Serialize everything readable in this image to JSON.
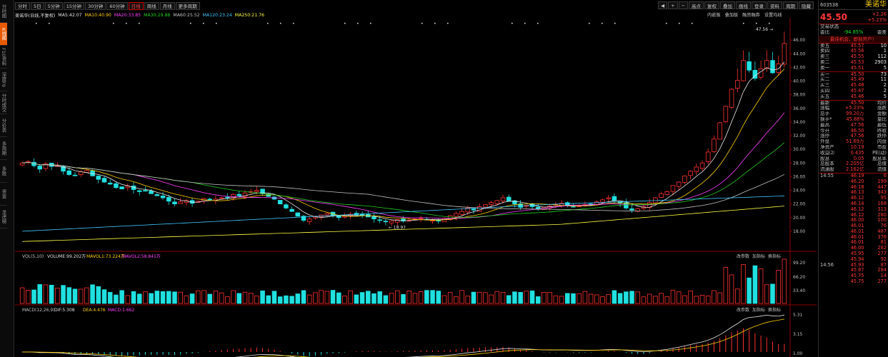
{
  "left_tabs": [
    "分时图",
    "K线图",
    "F10资料",
    "深度F9",
    "分时成交",
    "分价表",
    "多周期",
    "多股",
    "资金",
    "龙虎榜"
  ],
  "toolbar": {
    "periods": [
      "分时",
      "5日",
      "5分钟",
      "15分钟",
      "30分钟",
      "60分钟",
      "日线",
      "周线",
      "月线",
      "更多周期"
    ],
    "active": "日线",
    "right": [
      "高点",
      "复权",
      "叠加",
      "画线",
      "登录",
      "资料",
      "周期",
      "隐藏"
    ]
  },
  "ma_line": {
    "label": "美诺华(日线,不复权)",
    "items": [
      {
        "t": "MA5:42.07",
        "c": "#e8e8e8"
      },
      {
        "t": "MA10:40.90",
        "c": "#ffd000"
      },
      {
        "t": "MA20:33.85",
        "c": "#ff40ff"
      },
      {
        "t": "MA30:29.88",
        "c": "#20d020"
      },
      {
        "t": "MA60:25.52",
        "c": "#c0c0c0"
      },
      {
        "t": "MA120:23.24",
        "c": "#40c8ff"
      },
      {
        "t": "MA250:21.76",
        "c": "#ffff40"
      }
    ],
    "sub": [
      "内嵌版",
      "叠加版",
      "融资融券",
      "设置均线"
    ]
  },
  "price_axis": [
    "46.00",
    "44.00",
    "42.00",
    "40.00",
    "38.00",
    "36.00",
    "34.00",
    "32.00",
    "30.00",
    "28.00",
    "26.00",
    "24.00",
    "22.00",
    "20.00",
    "18.00"
  ],
  "annotations": {
    "high": "47.56",
    "low": "18.97"
  },
  "vol": {
    "title": "VOL(5,10)",
    "v": "VOLUME:99.202万",
    "m1": "MAVOL1:73.224万",
    "m2": "MAVOL2:58.841万",
    "axis": [
      "99.20",
      "66.20",
      "33.40"
    ],
    "btns": [
      "改参数",
      "加指标",
      "换指标"
    ]
  },
  "macd": {
    "title": "MACD(12,26,9)",
    "d": "DIF:5.308",
    "e": "DEA:4.476",
    "m": "MACD:1.662",
    "axis": [
      "5.31",
      "3.15",
      "1.00"
    ],
    "btns": [
      "改参数",
      "加指标",
      "换指标"
    ]
  },
  "quote": {
    "code": "603538",
    "name": "美诺华",
    "price": "45.50",
    "chg": "+2.26",
    "pct": "+5.23%",
    "tradestat": "交易状态",
    "webi": "委比",
    "webi_v": "-94.85%",
    "weichai": "委差",
    "banner": "最佳机会，即刻开户！"
  },
  "asks": [
    [
      "卖五",
      "45.57",
      "10"
    ],
    [
      "卖四",
      "45.56",
      "1"
    ],
    [
      "卖三",
      "45.55",
      "112"
    ],
    [
      "卖二",
      "45.53",
      "2903"
    ],
    [
      "卖一",
      "45.51",
      "5"
    ]
  ],
  "bids": [
    [
      "买一",
      "45.50",
      "73"
    ],
    [
      "买二",
      "45.49",
      "11"
    ],
    [
      "买三",
      "45.48",
      "2"
    ],
    [
      "买四",
      "45.47",
      "2"
    ],
    [
      "买五",
      "45.46",
      "5"
    ]
  ],
  "stats": [
    [
      "最新",
      "45.50",
      "均价"
    ],
    [
      "涨幅",
      "+5.23%",
      "涨跌"
    ],
    [
      "总手",
      "99.20万",
      "金额"
    ],
    [
      "换手*",
      "45.88%",
      "量比"
    ],
    [
      "最高",
      "47.56",
      "最低"
    ],
    [
      "今开",
      "46.50",
      "昨收"
    ],
    [
      "涨停",
      "47.56",
      "跌停"
    ],
    [
      "外盘",
      "51.69万",
      "内盘"
    ],
    [
      "净资产",
      "10.19",
      "市盈"
    ],
    [
      "收益⑵",
      "0.435",
      "PE(动)"
    ],
    [
      "股息",
      "0.05",
      "股息率"
    ],
    [
      "总股本",
      "2.205亿",
      "总值"
    ],
    [
      "流通股",
      "2.162亿",
      "流值"
    ]
  ],
  "ticks": [
    [
      "14:55",
      "46.19",
      "6"
    ],
    [
      "",
      "46.20",
      "199"
    ],
    [
      "",
      "46.18",
      "447"
    ],
    [
      "",
      "46.13",
      "343"
    ],
    [
      "",
      "46.12",
      "95"
    ],
    [
      "",
      "46.14",
      "168"
    ],
    [
      "",
      "46.12",
      "313"
    ],
    [
      "",
      "46.12",
      "280"
    ],
    [
      "",
      "46.00",
      "100"
    ],
    [
      "",
      "46.01",
      "76"
    ],
    [
      "",
      "46.01",
      "487"
    ],
    [
      "",
      "46.01",
      "376"
    ],
    [
      "",
      "46.01",
      "81"
    ],
    [
      "",
      "46.00",
      "282"
    ],
    [
      "",
      "45.95",
      "277"
    ],
    [
      "",
      "45.94",
      "92"
    ],
    [
      "14:56",
      "45.93",
      "87"
    ],
    [
      "",
      "45.87",
      "284"
    ],
    [
      "",
      "45.75",
      "14"
    ],
    [
      "",
      "45.75",
      "277"
    ]
  ],
  "chart_data": {
    "type": "candlestick",
    "title": "美诺华(日线,不复权)",
    "ylim": [
      16,
      48
    ],
    "high": 47.56,
    "low": 18.97,
    "ohlc_close": [
      28.0,
      28.2,
      27.6,
      27.1,
      27.9,
      27.5,
      27.6,
      26.8,
      26.3,
      26.2,
      26.7,
      26.9,
      26.1,
      25.6,
      25.2,
      24.9,
      24.4,
      24.2,
      24.6,
      24.1,
      23.8,
      23.9,
      23.5,
      23.2,
      22.9,
      22.4,
      22.0,
      22.3,
      22.5,
      22.1,
      22.4,
      22.8,
      22.6,
      22.7,
      22.9,
      23.0,
      23.4,
      23.2,
      23.6,
      23.8,
      24.0,
      23.5,
      23.1,
      22.7,
      22.0,
      21.4,
      20.9,
      20.2,
      19.6,
      19.8,
      20.1,
      20.4,
      20.6,
      20.3,
      20.0,
      20.2,
      20.5,
      20.4,
      20.3,
      20.1,
      19.8,
      19.6,
      19.4,
      19.5,
      19.7,
      19.5,
      19.6,
      19.8,
      19.9,
      19.7,
      19.6,
      19.5,
      19.9,
      20.3,
      20.6,
      20.9,
      21.4,
      21.1,
      21.6,
      21.9,
      22.2,
      22.5,
      22.9,
      22.4,
      22.0,
      21.5,
      21.8,
      21.6,
      21.3,
      21.5,
      21.7,
      21.9,
      22.1,
      21.8,
      21.6,
      21.7,
      21.9,
      22.0,
      22.3,
      22.6,
      22.9,
      22.5,
      22.1,
      21.4,
      21.1,
      21.3,
      21.6,
      22.2,
      22.9,
      23.5,
      23.8,
      24.7,
      25.2,
      26.1,
      26.8,
      27.4,
      28.0,
      29.6,
      31.5,
      33.9,
      36.3,
      38.8,
      40.1,
      43.0,
      41.6,
      40.4,
      41.8,
      43.0,
      41.2,
      42.5,
      45.5
    ],
    "ma5": 42.07,
    "ma10": 40.9,
    "ma20": 33.85,
    "ma30": 29.88,
    "ma60": 25.52,
    "ma120": 23.24,
    "ma250": 21.76
  }
}
